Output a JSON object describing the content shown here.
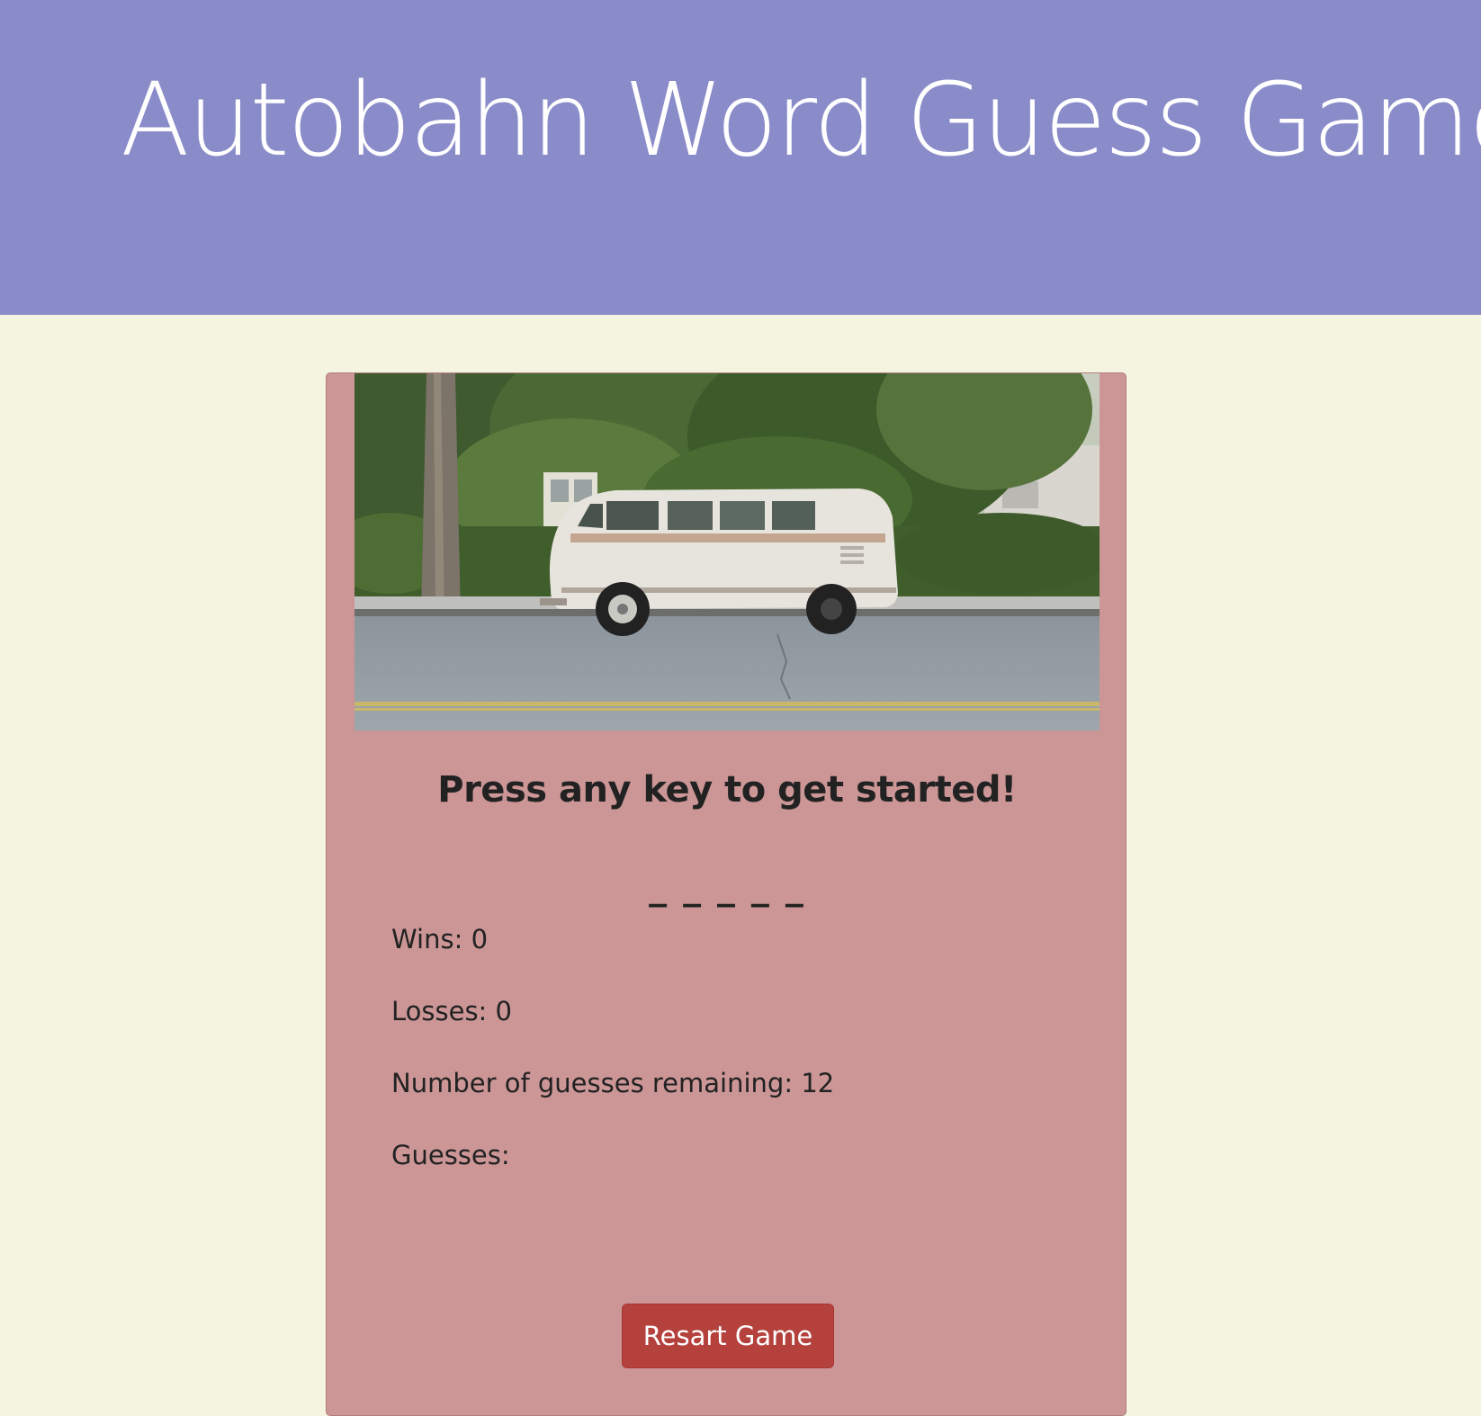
{
  "header": {
    "title": "Autobahn Word Guess Game",
    "background": "#8a8bc9"
  },
  "page": {
    "background": "#f5f4e0"
  },
  "card": {
    "background": "#cc9696",
    "image": "vw-bus-photo",
    "prompt": "Press any key to get started!",
    "blanks": "_ _ _ _ _",
    "stats": {
      "wins_label": "Wins: ",
      "wins_value": "0",
      "losses_label": "Losses: ",
      "losses_value": "0",
      "remaining_label": "Number of guesses remaining: ",
      "remaining_value": "12",
      "guesses_label": "Guesses: ",
      "guesses_value": ""
    },
    "restart_label": "Resart Game",
    "restart_color": "#b5413d"
  }
}
